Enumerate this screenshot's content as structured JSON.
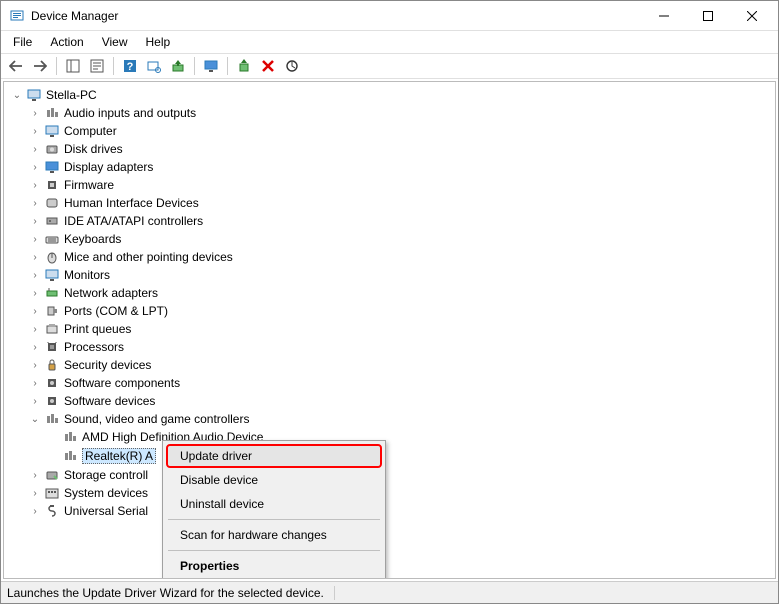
{
  "title": "Device Manager",
  "menubar": [
    "File",
    "Action",
    "View",
    "Help"
  ],
  "root": "Stella-PC",
  "categories": [
    "Audio inputs and outputs",
    "Computer",
    "Disk drives",
    "Display adapters",
    "Firmware",
    "Human Interface Devices",
    "IDE ATA/ATAPI controllers",
    "Keyboards",
    "Mice and other pointing devices",
    "Monitors",
    "Network adapters",
    "Ports (COM & LPT)",
    "Print queues",
    "Processors",
    "Security devices",
    "Software components",
    "Software devices",
    "Sound, video and game controllers",
    "Storage controll",
    "System devices",
    "Universal Serial"
  ],
  "sound_children": [
    "AMD High Definition Audio Device",
    "Realtek(R) A"
  ],
  "context_menu": {
    "update": "Update driver",
    "disable": "Disable device",
    "uninstall": "Uninstall device",
    "scan": "Scan for hardware changes",
    "properties": "Properties"
  },
  "status": "Launches the Update Driver Wizard for the selected device."
}
